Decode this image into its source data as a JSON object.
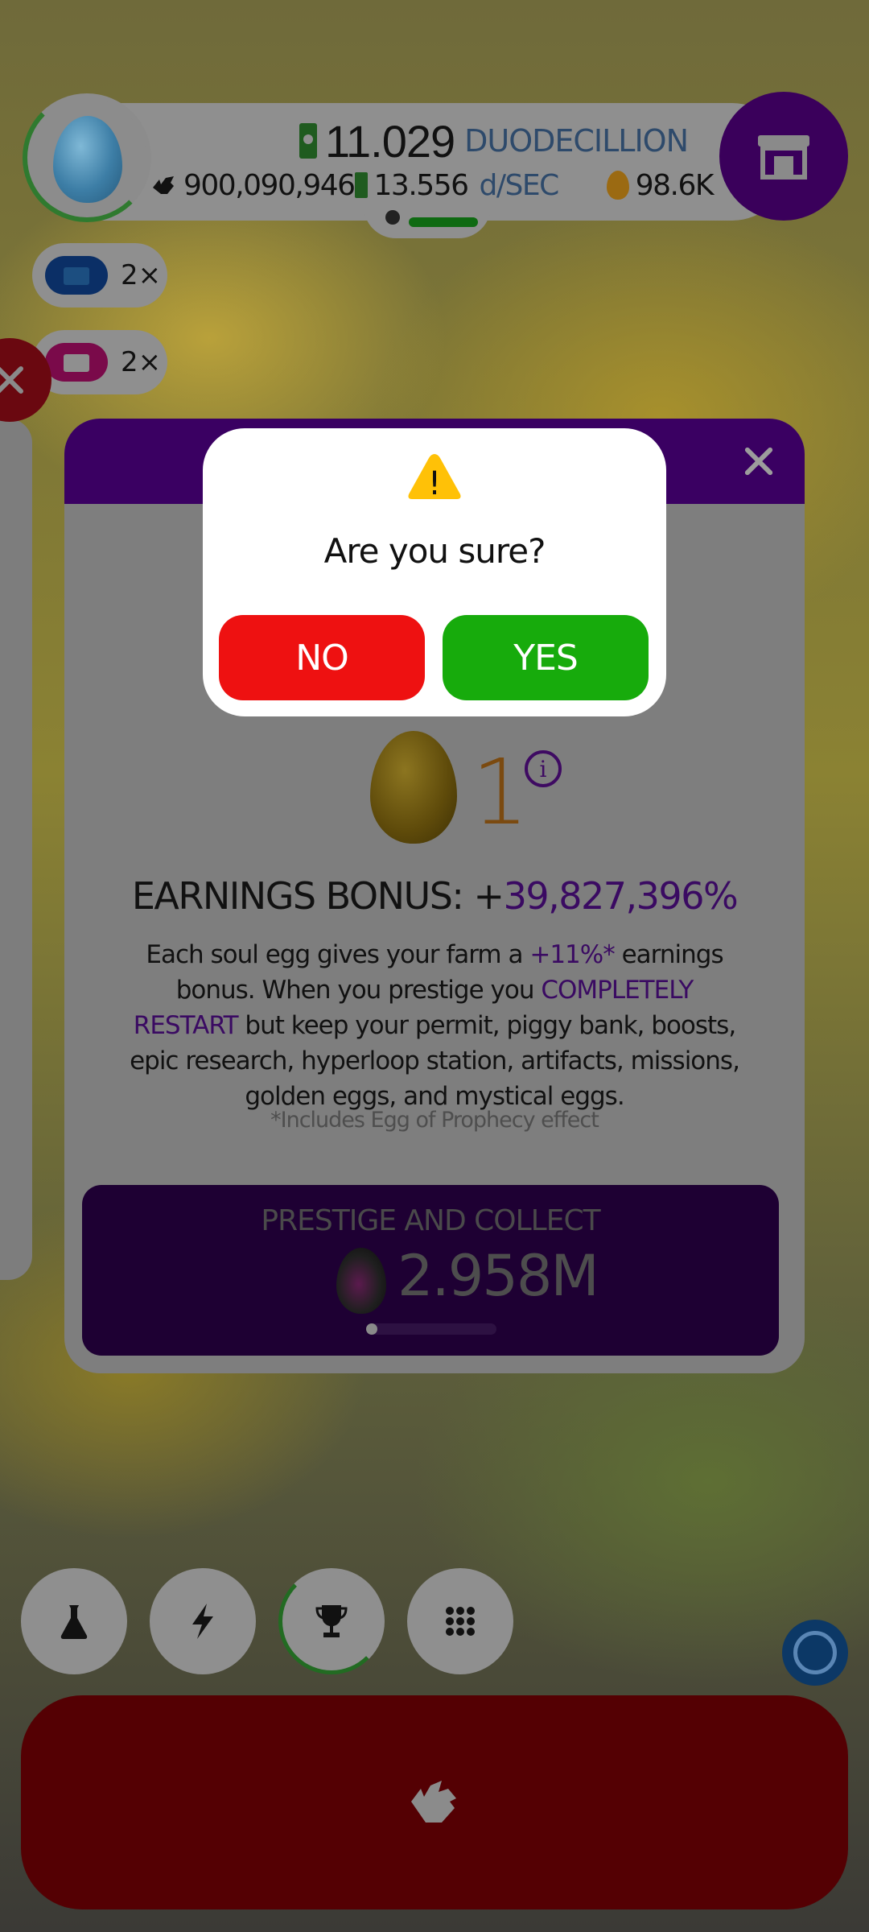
{
  "hud": {
    "money_value": "11.029",
    "money_unit": "DUODECILLION",
    "chickens": "900,090,946",
    "rate_value": "13.556",
    "rate_unit": "d/SEC",
    "golden_eggs": "98.6K"
  },
  "boosts": [
    {
      "multiplier": "2×",
      "color": "#0b2f66"
    },
    {
      "multiplier": "2×",
      "color": "#7a0a4a"
    }
  ],
  "panel": {
    "soul_egg_count": "1",
    "bonus_label": "EARNINGS BONUS: +",
    "bonus_value": "39,827,396%",
    "desc_1": "Each soul egg gives your farm a ",
    "desc_hl_1": "+11%*",
    "desc_2": " earnings bonus. When you prestige you ",
    "desc_hl_2": "COMPLETELY RESTART",
    "desc_3": " but keep your permit, piggy bank, boosts, epic research, hyperloop station, artifacts, missions, golden eggs, and mystical eggs.",
    "footnote": "*Includes Egg of Prophecy effect",
    "prestige_label": "PRESTIGE AND COLLECT",
    "prestige_value": "2.958M",
    "prestige_progress": 0.06
  },
  "dialog": {
    "warning_symbol": "!",
    "message": "Are you sure?",
    "no_label": "NO",
    "yes_label": "YES"
  },
  "colors": {
    "no": "#ee1111",
    "yes": "#17ab0c",
    "panel_header": "#3a0062",
    "shop": "#3a005b",
    "hatch": "#540003"
  },
  "icons": {
    "shop": "shop-icon",
    "research": "flask-icon",
    "boost": "lightning-icon",
    "trophy": "trophy-icon",
    "menu": "grid-icon",
    "hatch": "chicken-icon"
  }
}
